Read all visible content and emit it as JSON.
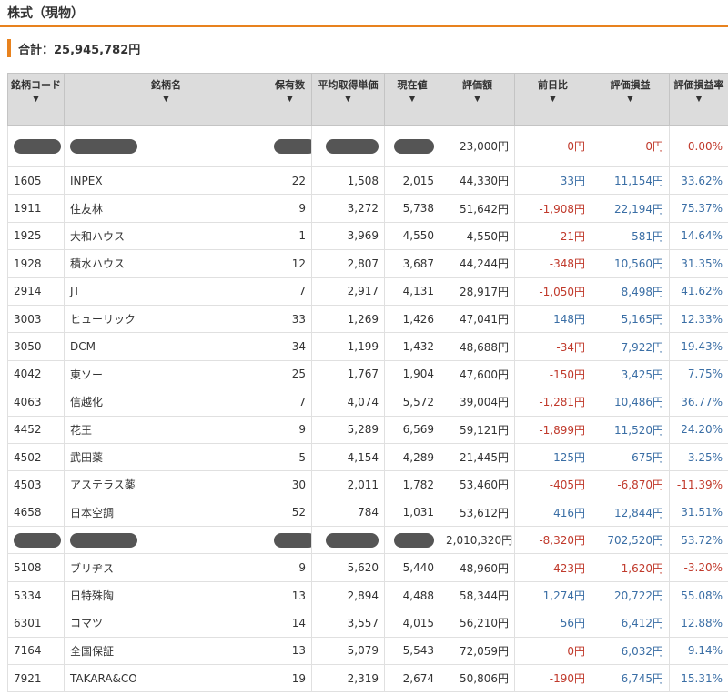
{
  "header": {
    "title": "株式（現物）"
  },
  "total": {
    "text": "合計：25,945,782円"
  },
  "table": {
    "headers": [
      {
        "label": "銘柄コード",
        "sort": "▼"
      },
      {
        "label": "銘柄名",
        "sort": "▼"
      },
      {
        "label": "保有数",
        "sort": "▼"
      },
      {
        "label": "平均取得単価",
        "sort": "▼"
      },
      {
        "label": "現在値",
        "sort": "▼"
      },
      {
        "label": "評価額",
        "sort": "▼"
      },
      {
        "label": "前日比",
        "sort": "▼"
      },
      {
        "label": "評価損益",
        "sort": "▼"
      },
      {
        "label": "評価損益率",
        "sort": "▼"
      }
    ],
    "rows": [
      {
        "code": "",
        "name": "",
        "qty": "",
        "avg": "",
        "price": "",
        "value": "23,000円",
        "change": "0円",
        "pl": "0円",
        "rate": "0.00%"
      },
      {
        "code": "1605",
        "name": "INPEX",
        "qty": "22",
        "avg": "1,508",
        "price": "2,015",
        "value": "44,330円",
        "change": "33円",
        "pl": "11,154円",
        "rate": "33.62%"
      },
      {
        "code": "1911",
        "name": "住友林",
        "qty": "9",
        "avg": "3,272",
        "price": "5,738",
        "value": "51,642円",
        "change": "-1,908円",
        "pl": "22,194円",
        "rate": "75.37%"
      },
      {
        "code": "1925",
        "name": "大和ハウス",
        "qty": "1",
        "avg": "3,969",
        "price": "4,550",
        "value": "4,550円",
        "change": "-21円",
        "pl": "581円",
        "rate": "14.64%"
      },
      {
        "code": "1928",
        "name": "積水ハウス",
        "qty": "12",
        "avg": "2,807",
        "price": "3,687",
        "value": "44,244円",
        "change": "-348円",
        "pl": "10,560円",
        "rate": "31.35%"
      },
      {
        "code": "2914",
        "name": "JT",
        "qty": "7",
        "avg": "2,917",
        "price": "4,131",
        "value": "28,917円",
        "change": "-1,050円",
        "pl": "8,498円",
        "rate": "41.62%"
      },
      {
        "code": "3003",
        "name": "ヒューリック",
        "qty": "33",
        "avg": "1,269",
        "price": "1,426",
        "value": "47,041円",
        "change": "148円",
        "pl": "5,165円",
        "rate": "12.33%"
      },
      {
        "code": "3050",
        "name": "DCM",
        "qty": "34",
        "avg": "1,199",
        "price": "1,432",
        "value": "48,688円",
        "change": "-34円",
        "pl": "7,922円",
        "rate": "19.43%"
      },
      {
        "code": "4042",
        "name": "東ソー",
        "qty": "25",
        "avg": "1,767",
        "price": "1,904",
        "value": "47,600円",
        "change": "-150円",
        "pl": "3,425円",
        "rate": "7.75%"
      },
      {
        "code": "4063",
        "name": "信越化",
        "qty": "7",
        "avg": "4,074",
        "price": "5,572",
        "value": "39,004円",
        "change": "-1,281円",
        "pl": "10,486円",
        "rate": "36.77%"
      },
      {
        "code": "4452",
        "name": "花王",
        "qty": "9",
        "avg": "5,289",
        "price": "6,569",
        "value": "59,121円",
        "change": "-1,899円",
        "pl": "11,520円",
        "rate": "24.20%"
      },
      {
        "code": "4502",
        "name": "武田薬",
        "qty": "5",
        "avg": "4,154",
        "price": "4,289",
        "value": "21,445円",
        "change": "125円",
        "pl": "675円",
        "rate": "3.25%"
      },
      {
        "code": "4503",
        "name": "アステラス薬",
        "qty": "30",
        "avg": "2,011",
        "price": "1,782",
        "value": "53,460円",
        "change": "-405円",
        "pl": "-6,870円",
        "rate": "-11.39%"
      },
      {
        "code": "4658",
        "name": "日本空調",
        "qty": "52",
        "avg": "784",
        "price": "1,031",
        "value": "53,612円",
        "change": "416円",
        "pl": "12,844円",
        "rate": "31.51%"
      },
      {
        "code": "",
        "name": "",
        "qty": "",
        "avg": "",
        "price": "",
        "value": "2,010,320円",
        "change": "-8,320円",
        "pl": "702,520円",
        "rate": "53.72%"
      },
      {
        "code": "5108",
        "name": "ブリヂス",
        "qty": "9",
        "avg": "5,620",
        "price": "5,440",
        "value": "48,960円",
        "change": "-423円",
        "pl": "-1,620円",
        "rate": "-3.20%"
      },
      {
        "code": "5334",
        "name": "日特殊陶",
        "qty": "13",
        "avg": "2,894",
        "price": "4,488",
        "value": "58,344円",
        "change": "1,274円",
        "pl": "20,722円",
        "rate": "55.08%"
      },
      {
        "code": "6301",
        "name": "コマツ",
        "qty": "14",
        "avg": "3,557",
        "price": "4,015",
        "value": "56,210円",
        "change": "56円",
        "pl": "6,412円",
        "rate": "12.88%"
      },
      {
        "code": "7164",
        "name": "全国保証",
        "qty": "13",
        "avg": "5,079",
        "price": "5,543",
        "value": "72,059円",
        "change": "0円",
        "pl": "6,032円",
        "rate": "9.14%"
      },
      {
        "code": "7921",
        "name": "TAKARA&CO",
        "qty": "19",
        "avg": "2,319",
        "price": "2,674",
        "value": "50,806円",
        "change": "-190円",
        "pl": "6,745円",
        "rate": "15.31%"
      }
    ]
  },
  "colors": {
    "accent": "#e8821e",
    "positive": "#3a6ea5",
    "negative": "#c0392b",
    "header_bg": "#dcdcdc",
    "redaction": "#555555"
  }
}
